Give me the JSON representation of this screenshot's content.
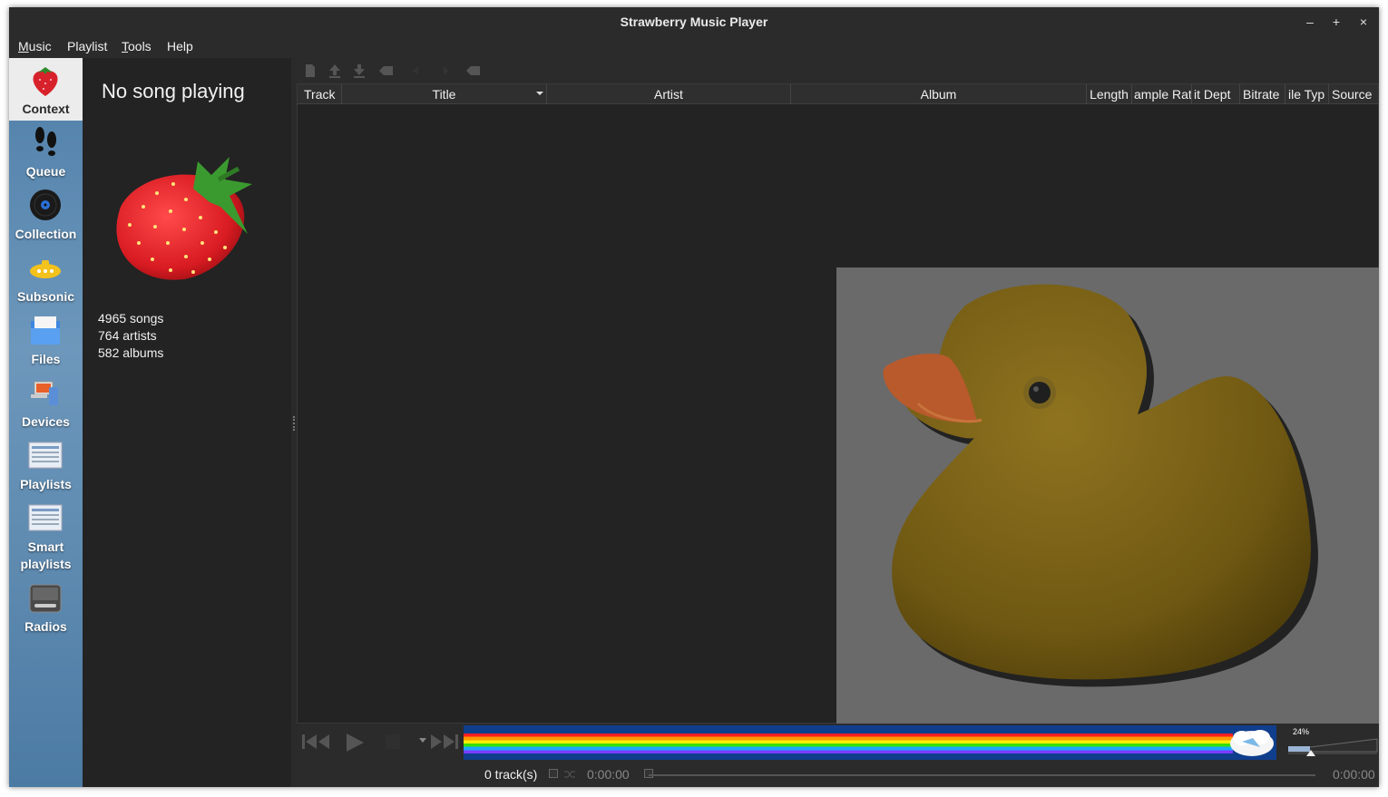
{
  "window": {
    "title": "Strawberry Music Player",
    "buttons": {
      "minimize": "–",
      "maximize": "+",
      "close": "×"
    }
  },
  "menubar": {
    "items": [
      {
        "label": "Music",
        "underline": "M",
        "rest": "usic"
      },
      {
        "label": "Playlist",
        "underline": "",
        "rest": "Playlist"
      },
      {
        "label": "Tools",
        "underline": "T",
        "rest": "ools"
      },
      {
        "label": "Help",
        "underline": "",
        "rest": "Help"
      }
    ]
  },
  "sidebar": {
    "items": [
      {
        "label": "Context",
        "icon": "strawberry-icon",
        "active": true
      },
      {
        "label": "Queue",
        "icon": "footsteps-icon",
        "active": false
      },
      {
        "label": "Collection",
        "icon": "vinyl-icon",
        "active": false
      },
      {
        "label": "Subsonic",
        "icon": "submarine-icon",
        "active": false
      },
      {
        "label": "Files",
        "icon": "folder-icon",
        "active": false
      },
      {
        "label": "Devices",
        "icon": "device-icon",
        "active": false
      },
      {
        "label": "Playlists",
        "icon": "playlist-icon",
        "active": false
      },
      {
        "label": "Smart",
        "label2": "playlists",
        "icon": "smart-playlist-icon",
        "active": false
      },
      {
        "label": "Radios",
        "icon": "radio-icon",
        "active": false
      }
    ]
  },
  "context": {
    "title": "No song playing",
    "stats": [
      "4965 songs",
      "764 artists",
      "582 albums"
    ]
  },
  "playlist": {
    "toolbar_icons": [
      "new-playlist-icon",
      "load-playlist-icon",
      "save-playlist-icon",
      "clear-playlist-icon",
      "undo-icon",
      "redo-icon",
      "clear-filter-icon"
    ],
    "columns": [
      "Track",
      "Title",
      "Artist",
      "Album",
      "Length",
      "ample Rat",
      "it Dept",
      "Bitrate",
      "ile Typ",
      "Source"
    ],
    "sort_column": "Title"
  },
  "player": {
    "volume_label": "24%",
    "volume": 0.24
  },
  "status": {
    "tracks": "0 track(s)",
    "time_elapsed": "0:00:00",
    "time_total": "0:00:00"
  },
  "colors": {
    "sidebar": "#5e8ab0",
    "background": "#232323",
    "nyan_bg": "#0f3e8c"
  }
}
